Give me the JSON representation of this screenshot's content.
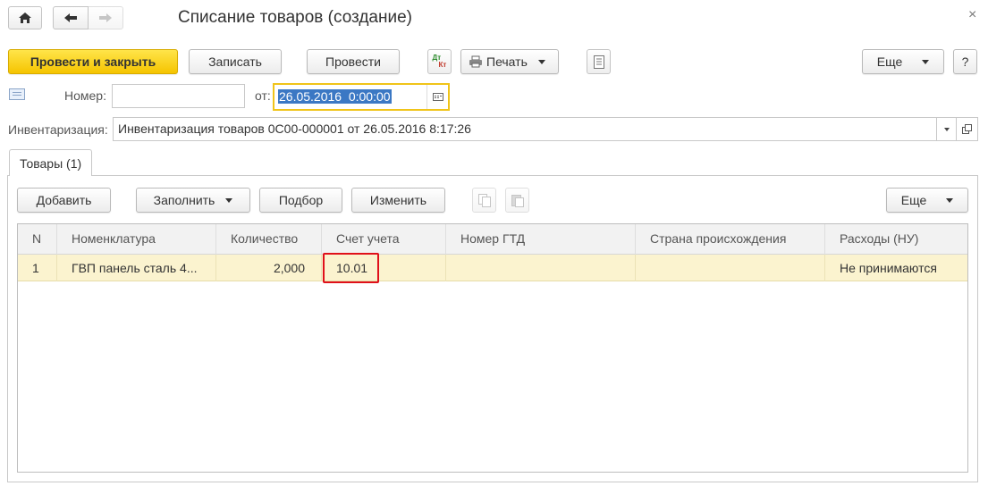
{
  "window": {
    "title": "Списание товаров (создание)"
  },
  "toolbar": {
    "post_and_close": "Провести и закрыть",
    "save": "Записать",
    "post": "Провести",
    "dtkt_top": "Дт",
    "dtkt_bottom": "Кт",
    "print": "Печать",
    "more": "Еще",
    "help": "?"
  },
  "header": {
    "number_label": "Номер:",
    "number_value": "",
    "date_label": "от:",
    "date_value": "26.05.2016  0:00:00",
    "inventory_label": "Инвентаризация:",
    "inventory_value": "Инвентаризация товаров 0С00-000001 от 26.05.2016 8:17:26"
  },
  "tabs": [
    {
      "label": "Товары (1)",
      "active": true
    }
  ],
  "table_toolbar": {
    "add": "Добавить",
    "fill": "Заполнить",
    "select": "Подбор",
    "edit": "Изменить",
    "more": "Еще"
  },
  "table": {
    "columns": [
      "N",
      "Номенклатура",
      "Количество",
      "Счет учета",
      "Номер ГТД",
      "Страна происхождения",
      "Расходы (НУ)"
    ],
    "rows": [
      {
        "n": "1",
        "item": "ГВП панель сталь 4...",
        "quantity": "2,000",
        "account": "10.01",
        "gtd": "",
        "country": "",
        "expenses": "Не принимаются"
      }
    ]
  },
  "colors": {
    "primary_button": "#f5c400",
    "selected_row": "#fbf3cf",
    "highlight_frame": "#e0101a",
    "date_field_border": "#f0c419",
    "selection": "#3b78c4"
  }
}
